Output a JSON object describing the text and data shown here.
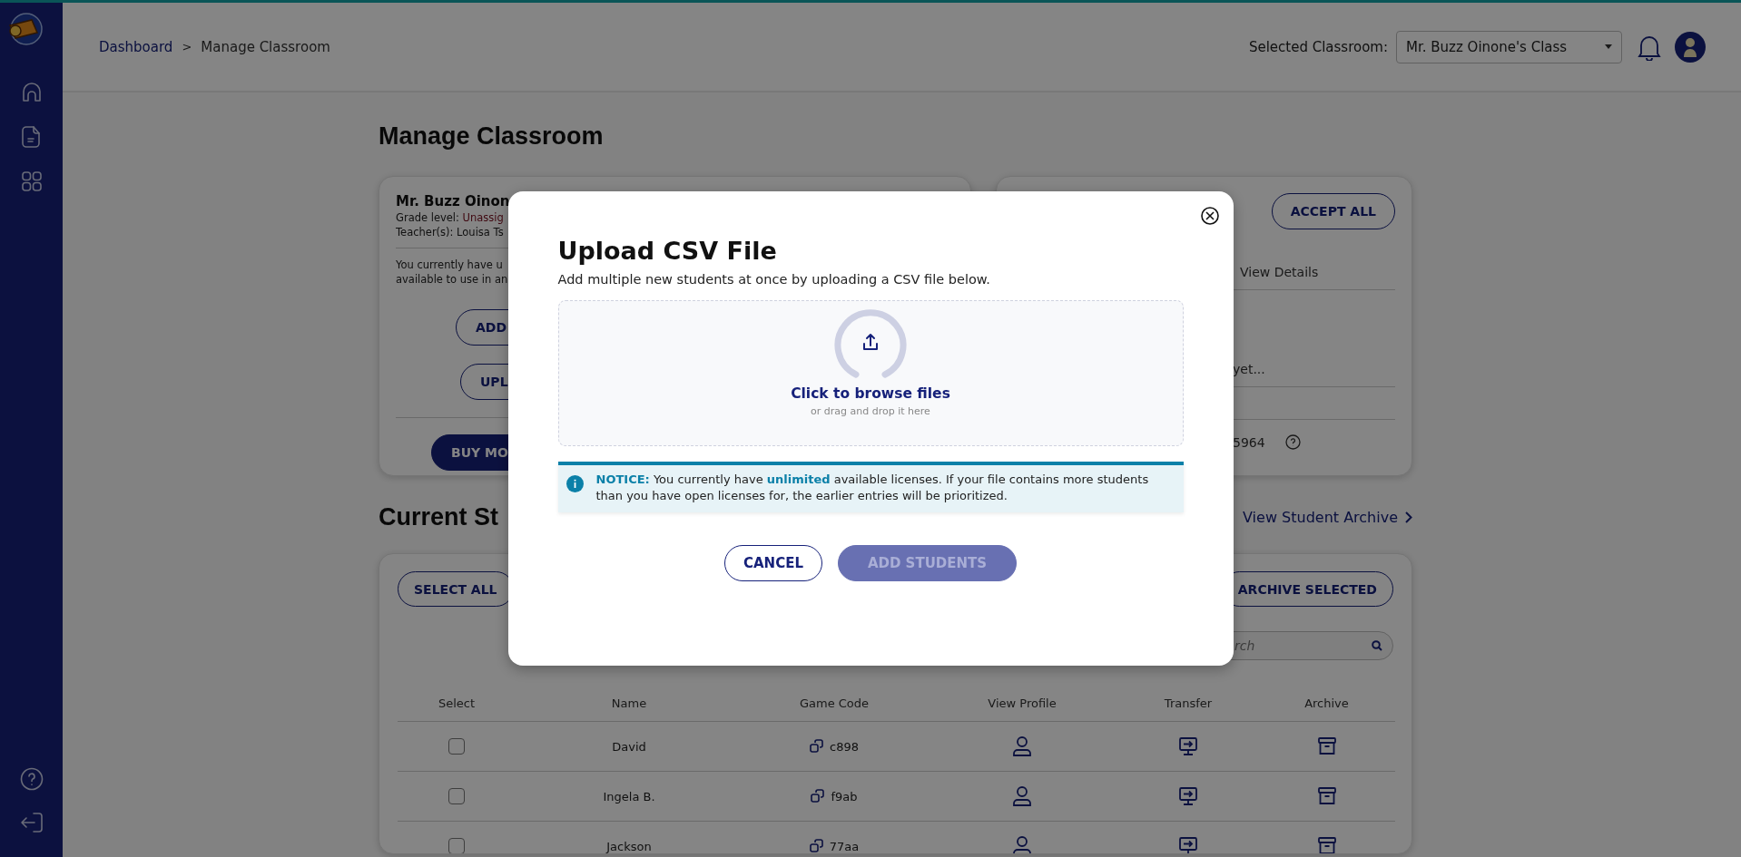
{
  "breadcrumb": {
    "items": [
      "Dashboard",
      "Manage Classroom"
    ],
    "separator": ">"
  },
  "classroom_select": {
    "label": "Selected Classroom:",
    "value": "Mr. Buzz Oinone's Class"
  },
  "page_title": "Manage Classroom",
  "class_card": {
    "name": "Mr. Buzz Oinon",
    "grade_label": "Grade level:",
    "grade_value": "Unassig",
    "teacher": "Teacher(s): Louisa Ts",
    "license_lines": [
      "You currently have u",
      "available to use in an"
    ],
    "buttons": [
      "ADD",
      "UPL"
    ],
    "buy_button": "BUY MO"
  },
  "requests_card": {
    "accept_button": "ACCEPT ALL",
    "column_header": "View Details",
    "empty_text": "yet...",
    "code": "5964"
  },
  "students": {
    "title": "Current St",
    "archive_link": "View Student Archive",
    "select_all_button": "SELECT ALL",
    "archive_selected_button": "ARCHIVE SELECTED",
    "search": {
      "placeholder": "rch"
    },
    "table": {
      "columns": [
        "Select",
        "Name",
        "Game Code",
        "View Profile",
        "Transfer",
        "Archive"
      ],
      "rows": [
        {
          "checked": false,
          "name": "David",
          "game_code": "c898"
        },
        {
          "checked": false,
          "name": "Ingela B.",
          "game_code": "f9ab"
        },
        {
          "checked": false,
          "name": "Jackson",
          "game_code": "77aa"
        }
      ]
    }
  },
  "modal": {
    "title": "Upload CSV File",
    "subtitle": "Add multiple new students at once by uploading a CSV file below.",
    "dropzone": {
      "action": "Click to browse files",
      "hint": "or drag and drop it here"
    },
    "notice": "**NOTICE:** You currently have **unlimited** available licenses. If your file contains more students than you have open licenses for, the earlier entries will be prioritized.",
    "buttons": [
      {
        "label": "CANCEL",
        "disabled": false
      },
      {
        "label": "ADD STUDENTS",
        "disabled": true
      }
    ]
  }
}
